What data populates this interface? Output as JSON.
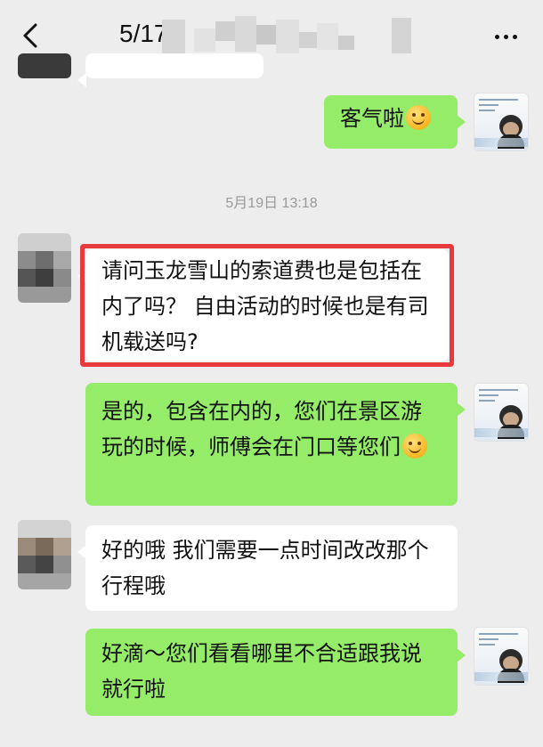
{
  "header": {
    "title": "5/17",
    "back_icon": "chevron-left-icon",
    "more_icon": "more-horizontal-icon"
  },
  "timestamp": "5月19日 13:18",
  "messages": [
    {
      "side": "right",
      "text": "客气啦",
      "emoji": "smile-emoji"
    },
    {
      "side": "left",
      "text": "请问玉龙雪山的索道费也是包括在内了吗？ 自由活动的时候也是有司机载送吗?",
      "highlighted": true
    },
    {
      "side": "right",
      "text": "是的，包含在内的，您们在景区游玩的时候，师傅会在门口等您们",
      "emoji": "smile-emoji"
    },
    {
      "side": "left",
      "text": "好的哦 我们需要一点时间改改那个行程哦"
    },
    {
      "side": "right",
      "text": "好滴～您们看看哪里不合适跟我说就行啦"
    }
  ],
  "colors": {
    "background": "#ededed",
    "outgoing_bubble": "#95ec69",
    "incoming_bubble": "#ffffff",
    "highlight_border": "#e8393c"
  }
}
